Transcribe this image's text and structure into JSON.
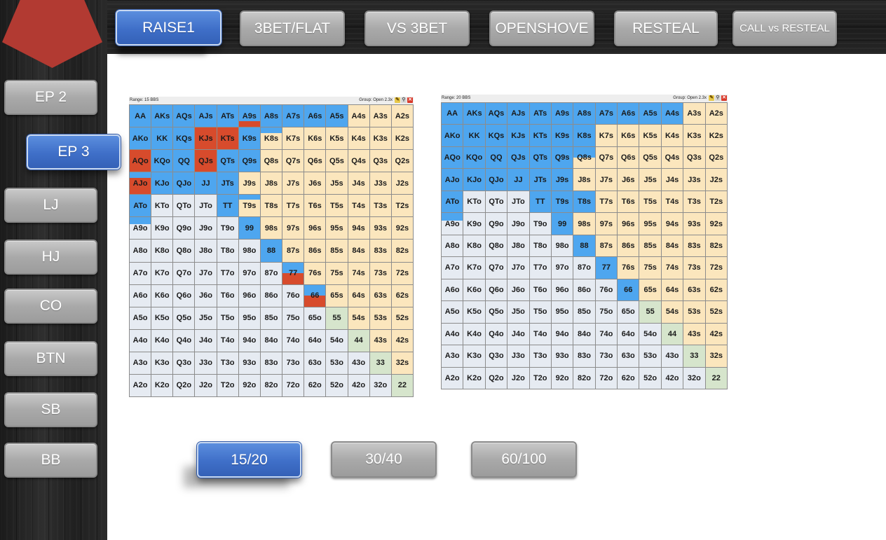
{
  "top_tabs": [
    {
      "label": "RAISE1",
      "active": true
    },
    {
      "label": "3BET/FLAT",
      "active": false
    },
    {
      "label": "VS 3BET",
      "active": false
    },
    {
      "label": "OPENSHOVE",
      "active": false
    },
    {
      "label": "RESTEAL",
      "active": false
    },
    {
      "label": "CALL vs RESTEAL",
      "active": false
    }
  ],
  "positions": [
    {
      "label": "EP 2",
      "active": false
    },
    {
      "label": "EP 3",
      "active": true
    },
    {
      "label": "LJ",
      "active": false
    },
    {
      "label": "HJ",
      "active": false
    },
    {
      "label": "CO",
      "active": false
    },
    {
      "label": "BTN",
      "active": false
    },
    {
      "label": "SB",
      "active": false
    },
    {
      "label": "BB",
      "active": false
    }
  ],
  "stack_tabs": [
    {
      "label": "15/20",
      "active": true
    },
    {
      "label": "30/40",
      "active": false
    },
    {
      "label": "60/100",
      "active": false
    }
  ],
  "colors": {
    "raise": "#4ea6ef",
    "call": "#d74b2c",
    "suited_bg": "#fbe6bd",
    "offsuit_bg": "#e6ebf2",
    "pair_bg": "#d6e5cc",
    "active_tab": "#3f6fc8",
    "pentagon": "#b23a32"
  },
  "icons": {
    "pencil": "pencil-icon",
    "wand": "wand-icon",
    "close": "close-icon"
  },
  "range_grids": [
    {
      "range_label": "Range: 15 BBS",
      "group_label": "Group: Open 2.3x",
      "rows": [
        [
          "AA",
          "AKs",
          "AQs",
          "AJs",
          "ATs",
          "A9s",
          "A8s",
          "A7s",
          "A6s",
          "A5s",
          "A4s",
          "A3s",
          "A2s"
        ],
        [
          "AKo",
          "KK",
          "KQs",
          "KJs",
          "KTs",
          "K9s",
          "K8s",
          "K7s",
          "K6s",
          "K5s",
          "K4s",
          "K3s",
          "K2s"
        ],
        [
          "AQo",
          "KQo",
          "QQ",
          "QJs",
          "QTs",
          "Q9s",
          "Q8s",
          "Q7s",
          "Q6s",
          "Q5s",
          "Q4s",
          "Q3s",
          "Q2s"
        ],
        [
          "AJo",
          "KJo",
          "QJo",
          "JJ",
          "JTs",
          "J9s",
          "J8s",
          "J7s",
          "J6s",
          "J5s",
          "J4s",
          "J3s",
          "J2s"
        ],
        [
          "ATo",
          "KTo",
          "QTo",
          "JTo",
          "TT",
          "T9s",
          "T8s",
          "T7s",
          "T6s",
          "T5s",
          "T4s",
          "T3s",
          "T2s"
        ],
        [
          "A9o",
          "K9o",
          "Q9o",
          "J9o",
          "T9o",
          "99",
          "98s",
          "97s",
          "96s",
          "95s",
          "94s",
          "93s",
          "92s"
        ],
        [
          "A8o",
          "K8o",
          "Q8o",
          "J8o",
          "T8o",
          "98o",
          "88",
          "87s",
          "86s",
          "85s",
          "84s",
          "83s",
          "82s"
        ],
        [
          "A7o",
          "K7o",
          "Q7o",
          "J7o",
          "T7o",
          "97o",
          "87o",
          "77",
          "76s",
          "75s",
          "74s",
          "73s",
          "72s"
        ],
        [
          "A6o",
          "K6o",
          "Q6o",
          "J6o",
          "T6o",
          "96o",
          "86o",
          "76o",
          "66",
          "65s",
          "64s",
          "63s",
          "62s"
        ],
        [
          "A5o",
          "K5o",
          "Q5o",
          "J5o",
          "T5o",
          "95o",
          "85o",
          "75o",
          "65o",
          "55",
          "54s",
          "53s",
          "52s"
        ],
        [
          "A4o",
          "K4o",
          "Q4o",
          "J4o",
          "T4o",
          "94o",
          "84o",
          "74o",
          "64o",
          "54o",
          "44",
          "43s",
          "42s"
        ],
        [
          "A3o",
          "K3o",
          "Q3o",
          "J3o",
          "T3o",
          "93o",
          "83o",
          "73o",
          "63o",
          "53o",
          "43o",
          "33",
          "32s"
        ],
        [
          "A2o",
          "K2o",
          "Q2o",
          "J2o",
          "T2o",
          "92o",
          "82o",
          "72o",
          "62o",
          "52o",
          "42o",
          "32o",
          "22"
        ]
      ],
      "actions": {
        "AA": "raise",
        "AKs": "raise",
        "AQs": "raise",
        "AJs": "raise",
        "ATs": "raise",
        "A9s": "raise|0.75:call|0.25",
        "A8s": "raise",
        "A7s": "raise",
        "A6s": "raise",
        "A5s": "raise",
        "AKo": "raise",
        "KK": "raise",
        "KQs": "raise",
        "KJs": "call",
        "KTs": "call",
        "K9s": "raise",
        "K8s": "raise|0.25",
        "AQo": "call",
        "KQo": "raise",
        "QQ": "raise",
        "QJs": "call",
        "QTs": "raise",
        "Q9s": "raise",
        "AJo": "raise|0.25:call|0.75",
        "KJo": "raise",
        "QJo": "raise",
        "JJ": "raise",
        "JTs": "raise",
        "ATo": "raise",
        "TT": "raise",
        "T9s": "raise|0.2",
        "A9o": "raise|0.3",
        "99": "raise",
        "88": "raise",
        "77": "raise|0.5:call|0.5",
        "66": "raise|0.5:call|0.5"
      }
    },
    {
      "range_label": "Range: 20 BBS",
      "group_label": "Group: Open 2.3x",
      "rows": [
        [
          "AA",
          "AKs",
          "AQs",
          "AJs",
          "ATs",
          "A9s",
          "A8s",
          "A7s",
          "A6s",
          "A5s",
          "A4s",
          "A3s",
          "A2s"
        ],
        [
          "AKo",
          "KK",
          "KQs",
          "KJs",
          "KTs",
          "K9s",
          "K8s",
          "K7s",
          "K6s",
          "K5s",
          "K4s",
          "K3s",
          "K2s"
        ],
        [
          "AQo",
          "KQo",
          "QQ",
          "QJs",
          "QTs",
          "Q9s",
          "Q8s",
          "Q7s",
          "Q6s",
          "Q5s",
          "Q4s",
          "Q3s",
          "Q2s"
        ],
        [
          "AJo",
          "KJo",
          "QJo",
          "JJ",
          "JTs",
          "J9s",
          "J8s",
          "J7s",
          "J6s",
          "J5s",
          "J4s",
          "J3s",
          "J2s"
        ],
        [
          "ATo",
          "KTo",
          "QTo",
          "JTo",
          "TT",
          "T9s",
          "T8s",
          "T7s",
          "T6s",
          "T5s",
          "T4s",
          "T3s",
          "T2s"
        ],
        [
          "A9o",
          "K9o",
          "Q9o",
          "J9o",
          "T9o",
          "99",
          "98s",
          "97s",
          "96s",
          "95s",
          "94s",
          "93s",
          "92s"
        ],
        [
          "A8o",
          "K8o",
          "Q8o",
          "J8o",
          "T8o",
          "98o",
          "88",
          "87s",
          "86s",
          "85s",
          "84s",
          "83s",
          "82s"
        ],
        [
          "A7o",
          "K7o",
          "Q7o",
          "J7o",
          "T7o",
          "97o",
          "87o",
          "77",
          "76s",
          "75s",
          "74s",
          "73s",
          "72s"
        ],
        [
          "A6o",
          "K6o",
          "Q6o",
          "J6o",
          "T6o",
          "96o",
          "86o",
          "76o",
          "66",
          "65s",
          "64s",
          "63s",
          "62s"
        ],
        [
          "A5o",
          "K5o",
          "Q5o",
          "J5o",
          "T5o",
          "95o",
          "85o",
          "75o",
          "65o",
          "55",
          "54s",
          "53s",
          "52s"
        ],
        [
          "A4o",
          "K4o",
          "Q4o",
          "J4o",
          "T4o",
          "94o",
          "84o",
          "74o",
          "64o",
          "54o",
          "44",
          "43s",
          "42s"
        ],
        [
          "A3o",
          "K3o",
          "Q3o",
          "J3o",
          "T3o",
          "93o",
          "83o",
          "73o",
          "63o",
          "53o",
          "43o",
          "33",
          "32s"
        ],
        [
          "A2o",
          "K2o",
          "Q2o",
          "J2o",
          "T2o",
          "92o",
          "82o",
          "72o",
          "62o",
          "52o",
          "42o",
          "32o",
          "22"
        ]
      ],
      "actions": {
        "AA": "raise",
        "AKs": "raise",
        "AQs": "raise",
        "AJs": "raise",
        "ATs": "raise",
        "A9s": "raise",
        "A8s": "raise",
        "A7s": "raise",
        "A6s": "raise",
        "A5s": "raise",
        "A4s": "raise",
        "AKo": "raise",
        "KK": "raise",
        "KQs": "raise",
        "KJs": "raise",
        "KTs": "raise",
        "K9s": "raise",
        "K8s": "raise",
        "AQo": "raise",
        "KQo": "raise",
        "QQ": "raise",
        "QJs": "raise",
        "QTs": "raise",
        "Q9s": "raise",
        "Q8s": "raise|0.5",
        "AJo": "raise",
        "KJo": "raise",
        "QJo": "raise",
        "JJ": "raise",
        "JTs": "raise",
        "J9s": "raise",
        "ATo": "raise",
        "TT": "raise",
        "T9s": "raise",
        "T8s": "raise",
        "A9o": "raise|0.35",
        "99": "raise",
        "88": "raise",
        "77": "raise",
        "66": "raise"
      }
    }
  ]
}
